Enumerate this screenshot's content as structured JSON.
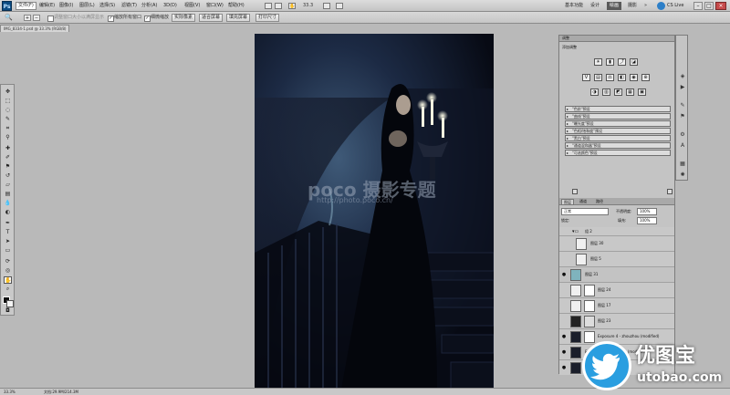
{
  "app": {
    "logo": "Ps"
  },
  "menu": [
    "文件(F)",
    "编辑(E)",
    "图像(I)",
    "图层(L)",
    "选择(S)",
    "滤镜(T)",
    "分析(A)",
    "3D(D)",
    "视图(V)",
    "窗口(W)",
    "帮助(H)"
  ],
  "toolbar_right": {
    "zoom": "33.3",
    "workspaces": [
      "基本功能",
      "设计",
      "绘画",
      "摄影"
    ],
    "active_workspace": "绘画",
    "cslive": "CS Live"
  },
  "options": {
    "resize_windows": "调整窗口大小以满屏显示",
    "zoom_all": "缩放所有窗口",
    "scrubby_zoom": "细微缩放",
    "actual_pixels": "实际像素",
    "fit_screen": "适合屏幕",
    "fill_screen": "填充屏幕",
    "print_size": "打印尺寸"
  },
  "document": {
    "tab_title": "IMG_8334-1.psd @ 33.3% (RGB/8)",
    "zoom": "33.3%",
    "doc_size": "文档:29.9M/214.3M"
  },
  "watermark": {
    "brand": "poco 摄影专题",
    "url": "http://photo.poco.cn/"
  },
  "adjustments": {
    "panel_title": "调整",
    "add_label": "添加调整",
    "presets": [
      "\"色阶\"预设",
      "\"曲线\"预设",
      "\"曝光度\"预设",
      "\"色相/饱和度\"预设",
      "\"黑白\"预设",
      "\"通道混和器\"预设",
      "\"可选颜色\"预设"
    ]
  },
  "layers": {
    "tabs": [
      "图层",
      "通道",
      "路径"
    ],
    "blend_mode": "正常",
    "opacity_label": "不透明度:",
    "opacity": "100%",
    "lock_label": "锁定:",
    "fill_label": "填充:",
    "fill": "100%",
    "items": [
      {
        "name": "组 2"
      },
      {
        "name": "图层 30"
      },
      {
        "name": "图层 5"
      },
      {
        "name": "图层 31"
      },
      {
        "name": "图层 24"
      },
      {
        "name": "图层 17"
      },
      {
        "name": "图层 23"
      },
      {
        "name": "Exposure 4 - zhouzhou (modified)"
      },
      {
        "name": "Exposure 4 - zhouzhou (modified)"
      },
      {
        "name": "背景"
      }
    ]
  },
  "branding": {
    "text_cn": "优图宝",
    "url": "utobao.com"
  },
  "colors": {
    "accent": "#0c4b82",
    "selected_layer": "#9fb4c9",
    "brand_blue": "#2a9ee0"
  }
}
